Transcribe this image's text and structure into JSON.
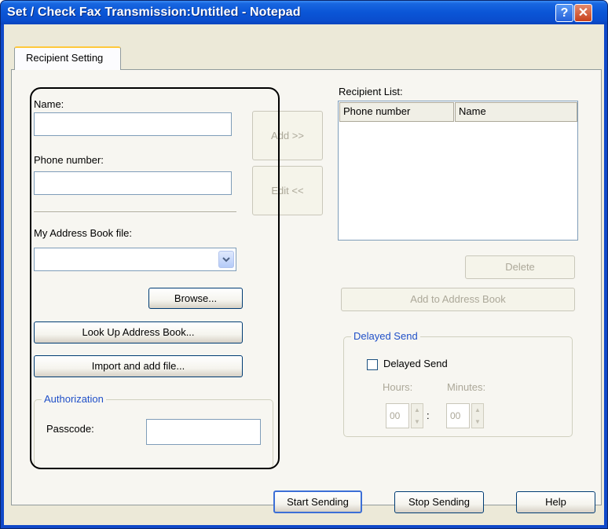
{
  "window": {
    "title": "Set / Check Fax Transmission:Untitled - Notepad",
    "help_glyph": "?",
    "close_glyph": "✕"
  },
  "tabs": [
    {
      "label": "Recipient Setting"
    }
  ],
  "left": {
    "name_label": "Name:",
    "name_value": "",
    "phone_label": "Phone number:",
    "phone_value": "",
    "address_book_label": "My Address Book file:",
    "address_book_value": "",
    "browse_button": "Browse...",
    "lookup_button": "Look Up Address Book...",
    "import_button": "Import and add file...",
    "authorization": {
      "legend": "Authorization",
      "passcode_label": "Passcode:",
      "passcode_value": ""
    }
  },
  "middle": {
    "add_button": "Add >>",
    "edit_button": "Edit <<"
  },
  "right": {
    "recipient_list_label": "Recipient List:",
    "columns": [
      "Phone number",
      "Name"
    ],
    "rows": [],
    "delete_button": "Delete",
    "add_to_book_button": "Add to Address Book",
    "delayed_send": {
      "legend": "Delayed Send",
      "checkbox_label": "Delayed Send",
      "checked": false,
      "hours_label": "Hours:",
      "minutes_label": "Minutes:",
      "hours_value": "00",
      "minutes_value": "00",
      "separator": ":"
    }
  },
  "footer": {
    "start_button": "Start Sending",
    "stop_button": "Stop Sending",
    "help_button": "Help"
  },
  "colors": {
    "titlebar": "#0a55d6",
    "dialog_bg": "#ece9d8",
    "disabled_text": "#aca899"
  }
}
